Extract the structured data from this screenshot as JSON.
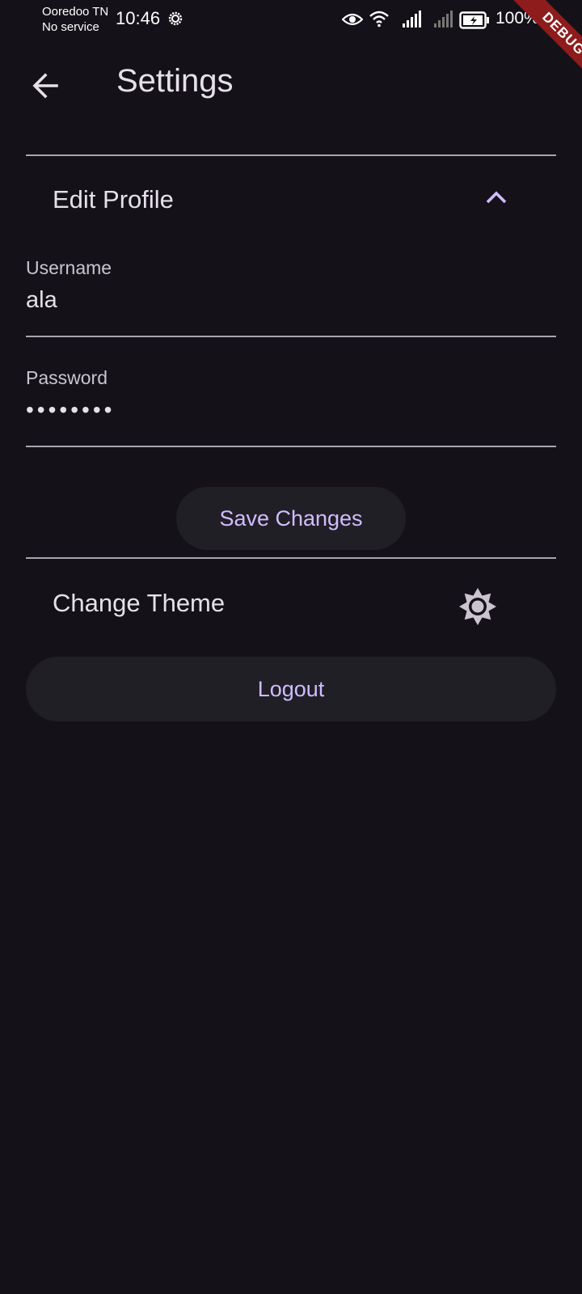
{
  "status_bar": {
    "carrier": "Ooredoo TN",
    "service": "No service",
    "time": "10:46",
    "battery": "100%",
    "icons": [
      "settings-gear-icon",
      "eye-icon",
      "wifi-icon",
      "signal-icon",
      "signal-icon",
      "battery-charging-icon"
    ]
  },
  "debug_banner": "DEBUG",
  "app_bar": {
    "back_icon": "arrow-back-icon",
    "title": "Settings"
  },
  "edit_profile": {
    "title": "Edit Profile",
    "expanded": true,
    "expand_icon": "chevron-up-icon",
    "username": {
      "label": "Username",
      "value": "ala"
    },
    "password": {
      "label": "Password",
      "value": "••••••••"
    },
    "save_label": "Save Changes"
  },
  "change_theme": {
    "title": "Change Theme",
    "icon": "brightness-icon"
  },
  "logout_label": "Logout",
  "colors": {
    "background": "#141218",
    "accent": "#d0bcff",
    "button_bg": "#211f26",
    "text": "#e6e0e9",
    "debug": "#8e1c1c"
  }
}
